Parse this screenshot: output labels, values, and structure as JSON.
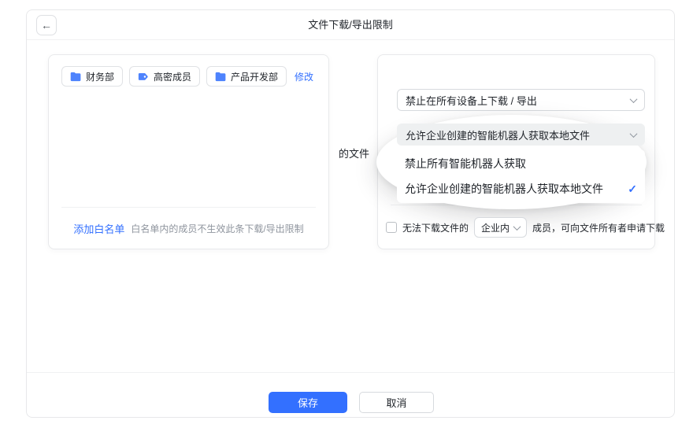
{
  "window": {
    "title": "文件下载/导出限制"
  },
  "icons": {
    "back": "←",
    "check": "✓"
  },
  "left_panel": {
    "tags": [
      {
        "label": "财务部",
        "icon": "folder"
      },
      {
        "label": "高密成员",
        "icon": "tag"
      },
      {
        "label": "产品开发部",
        "icon": "folder"
      }
    ],
    "modify_link": "修改",
    "add_whitelist_link": "添加白名单",
    "whitelist_hint": "白名单内的成员不生效此条下载/导出限制"
  },
  "connector_label": "的文件",
  "right_panel": {
    "device_restriction_select": {
      "value": "禁止在所有设备上下载 / 导出"
    },
    "robot_access_select": {
      "value": "允许企业创建的智能机器人获取本地文件",
      "options": [
        {
          "label": "禁止所有智能机器人获取",
          "selected": false
        },
        {
          "label": "允许企业创建的智能机器人获取本地文件",
          "selected": true
        }
      ]
    },
    "request_download_row": {
      "checked": false,
      "text_before": "无法下载文件的",
      "scope_select_value": "企业内",
      "text_after": "成员，可向文件所有者申请下载"
    }
  },
  "footer": {
    "save_label": "保存",
    "cancel_label": "取消"
  },
  "colors": {
    "accent": "#3370ff",
    "icon_blue": "#4e83fd"
  }
}
